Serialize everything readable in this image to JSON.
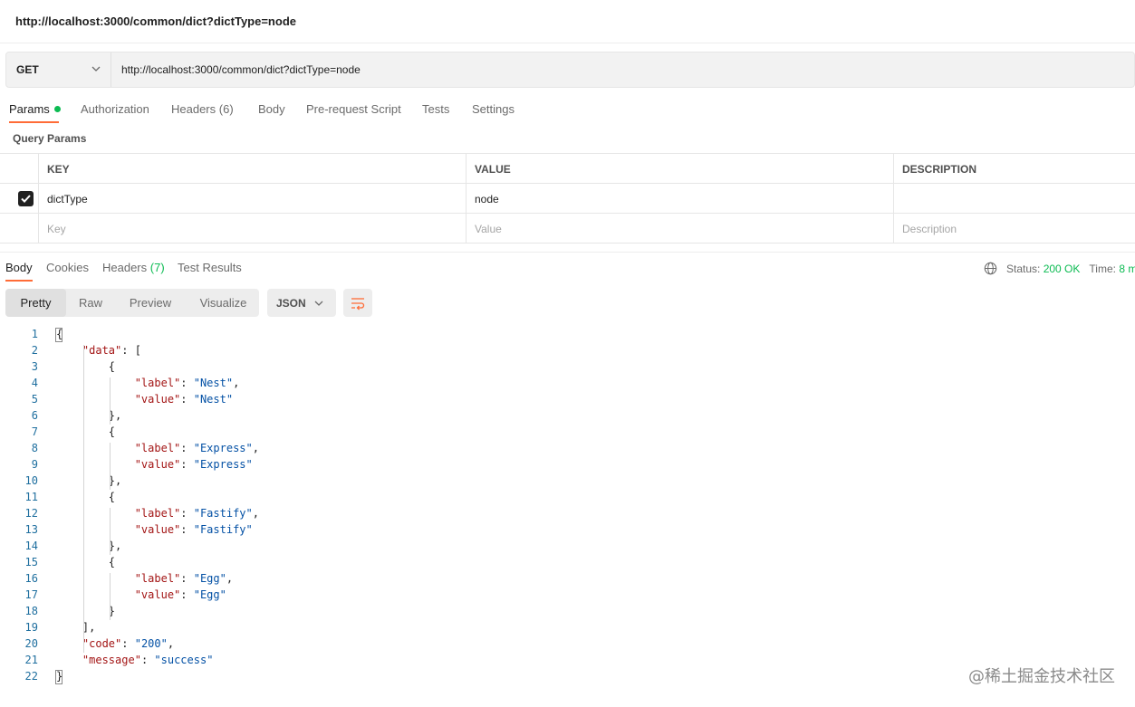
{
  "window": {
    "url_title": "http://localhost:3000/common/dict?dictType=node"
  },
  "request": {
    "method": "GET",
    "url": "http://localhost:3000/common/dict?dictType=node"
  },
  "request_tabs": [
    {
      "label": "Params",
      "count": ""
    },
    {
      "label": "Authorization",
      "count": ""
    },
    {
      "label": "Headers",
      "count": "(6)"
    },
    {
      "label": "Body",
      "count": ""
    },
    {
      "label": "Pre-request Script",
      "count": ""
    },
    {
      "label": "Tests",
      "count": ""
    },
    {
      "label": "Settings",
      "count": ""
    }
  ],
  "query_params": {
    "title": "Query Params",
    "headers": [
      "KEY",
      "VALUE",
      "DESCRIPTION"
    ],
    "rows": [
      {
        "key": "dictType",
        "value": "node",
        "description": "",
        "checked": true
      }
    ],
    "placeholders": {
      "key": "Key",
      "value": "Value",
      "description": "Description"
    }
  },
  "response_tabs": [
    {
      "label": "Body",
      "count": ""
    },
    {
      "label": "Cookies",
      "count": ""
    },
    {
      "label": "Headers",
      "count": "(7)"
    },
    {
      "label": "Test Results",
      "count": ""
    }
  ],
  "response_status": {
    "status_label": "Status:",
    "status_value": "200 OK",
    "time_label": "Time:",
    "time_value": "8 m"
  },
  "view_modes": [
    "Pretty",
    "Raw",
    "Preview",
    "Visualize"
  ],
  "format": "JSON",
  "code_lines": [
    "{",
    "    \"data\": [",
    "        {",
    "            \"label\": \"Nest\",",
    "            \"value\": \"Nest\"",
    "        },",
    "        {",
    "            \"label\": \"Express\",",
    "            \"value\": \"Express\"",
    "        },",
    "        {",
    "            \"label\": \"Fastify\",",
    "            \"value\": \"Fastify\"",
    "        },",
    "        {",
    "            \"label\": \"Egg\",",
    "            \"value\": \"Egg\"",
    "        }",
    "    ],",
    "    \"code\": \"200\",",
    "    \"message\": \"success\"",
    "}"
  ],
  "watermark": "@稀土掘金技术社区",
  "colors": {
    "accent": "#ff6c37",
    "success": "#0cbb52",
    "key": "#a31515",
    "string": "#0451a5"
  }
}
